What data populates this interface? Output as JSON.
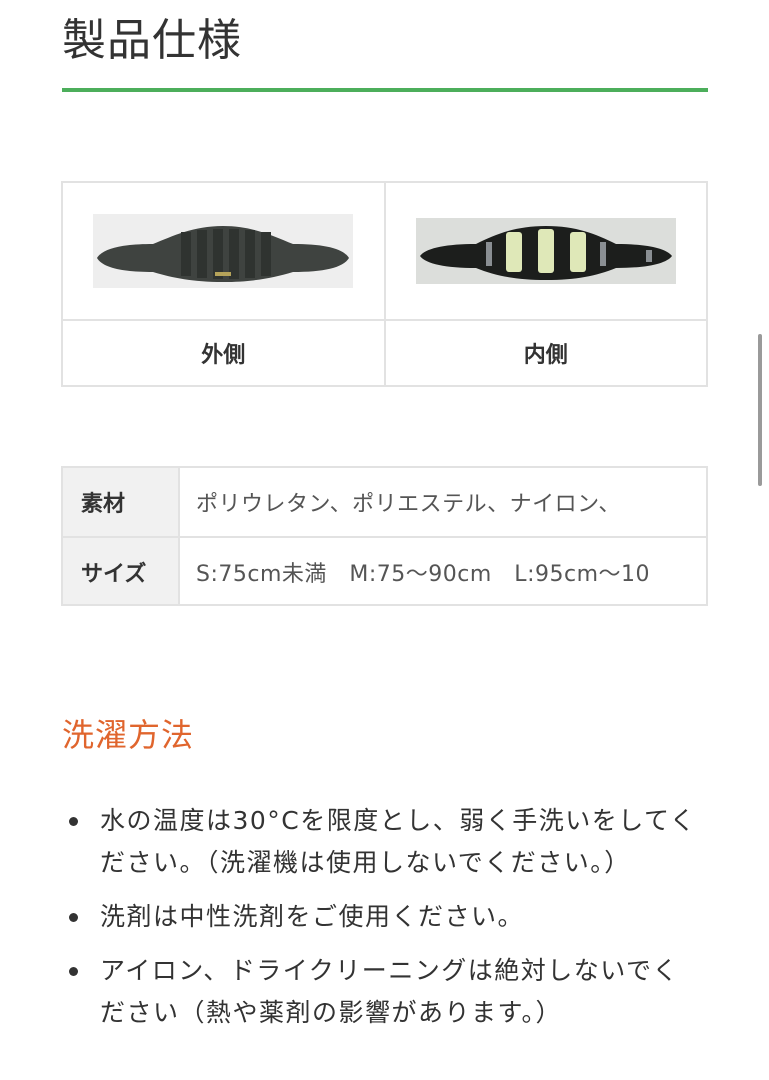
{
  "page": {
    "title": "製品仕様"
  },
  "photos": [
    {
      "caption": "外側",
      "image": "belt-outer-photo"
    },
    {
      "caption": "内側",
      "image": "belt-inner-photo"
    }
  ],
  "specs": [
    {
      "label": "素材",
      "value": "ポリウレタン、ポリエステル、ナイロン、"
    },
    {
      "label": "サイズ",
      "value": "S:75cm未満　M:75〜90cm　L:95cm〜10"
    }
  ],
  "washing": {
    "heading": "洗濯方法",
    "items": [
      "水の温度は30°Cを限度とし、弱く手洗いをしてください。（洗濯機は使用しないでください。）",
      "洗剤は中性洗剤をご使用ください。",
      "アイロン、ドライクリーニングは絶対しないでください（熱や薬剤の影響があります。）"
    ]
  },
  "colors": {
    "accent_rule": "#4cae5b",
    "wash_heading": "#e0652d",
    "table_border": "#e2e2e2",
    "spec_header_bg": "#f1f1f1"
  }
}
